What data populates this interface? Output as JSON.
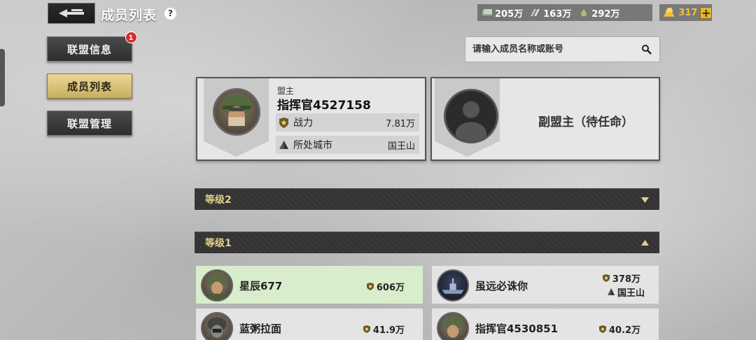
{
  "header": {
    "title": "成员列表",
    "help": "?"
  },
  "resources": {
    "cash": "205万",
    "steel": "163万",
    "oil": "292万",
    "gold": "317",
    "gold_plus": "+"
  },
  "side_menu": [
    {
      "label": "联盟信息",
      "badge": "1",
      "active": false
    },
    {
      "label": "成员列表",
      "active": true
    },
    {
      "label": "联盟管理",
      "active": false
    }
  ],
  "search": {
    "placeholder": "请输入成员名称或账号"
  },
  "leader": {
    "role": "盟主",
    "name": "指挥官4527158",
    "power_label": "战力",
    "power_value": "7.81万",
    "city_label": "所处城市",
    "city_value": "国王山"
  },
  "vice_leader": {
    "text": "副盟主（待任命）"
  },
  "sections": [
    {
      "label": "等级2",
      "expanded": false
    },
    {
      "label": "等级1",
      "expanded": true
    }
  ],
  "members": [
    {
      "name": "星辰677",
      "power": "606万",
      "highlight": true
    },
    {
      "name": "虽远必诛你",
      "power": "378万",
      "city": "国王山"
    },
    {
      "name": "蓝粥拉面",
      "power": "41.9万"
    },
    {
      "name": "指挥官4530851",
      "power": "40.2万"
    }
  ],
  "colors": {
    "accent_gold": "#e2cf8a",
    "active_tab": "#c8ae5e",
    "highlight_row": "#d8edcc",
    "badge_red": "#d62c2c"
  }
}
